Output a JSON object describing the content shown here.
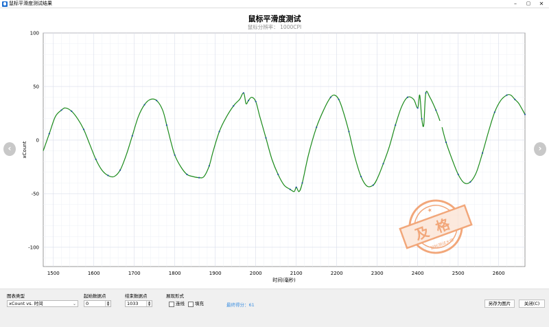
{
  "window": {
    "title": "鼠标平滑度测试结果",
    "minimize": "–",
    "maximize": "▢",
    "close": "✕"
  },
  "chart_data": {
    "type": "line",
    "title": "鼠标平滑度测试",
    "subtitle": "鼠标分辨率： 1000CPI",
    "xlabel": "时间(毫秒)",
    "ylabel": "xCount",
    "xlim": [
      1475,
      2665
    ],
    "ylim": [
      -118,
      100
    ],
    "xticks": [
      1500,
      1600,
      1700,
      1800,
      1900,
      2000,
      2100,
      2200,
      2300,
      2400,
      2500,
      2600
    ],
    "yticks": [
      100,
      50,
      0,
      -50,
      -100
    ],
    "grid": true,
    "series": [
      {
        "color": "#1a8a1a",
        "x": [
          1475,
          1490,
          1505,
          1520,
          1530,
          1545,
          1560,
          1575,
          1590,
          1605,
          1620,
          1635,
          1650,
          1665,
          1680,
          1695,
          1710,
          1725,
          1740,
          1755,
          1770,
          1780,
          1790,
          1800,
          1815,
          1830,
          1845,
          1860,
          1872,
          1885,
          1895,
          1910,
          1925,
          1945,
          1960,
          1970,
          1976,
          1982,
          1990,
          2000,
          2010,
          2025,
          2040,
          2055,
          2070,
          2085,
          2095,
          2100,
          2107,
          2115,
          2130,
          2150,
          2170,
          2185,
          2195,
          2205,
          2215,
          2230,
          2245,
          2260,
          2275,
          2290,
          2300,
          2315,
          2330,
          2345,
          2360,
          2375,
          2390,
          2400,
          2405,
          2410,
          2415,
          2420,
          2430,
          2445,
          2455
        ],
        "y": [
          -10,
          6,
          22,
          28,
          30,
          27,
          20,
          10,
          -4,
          -18,
          -28,
          -33,
          -34,
          -28,
          -14,
          4,
          22,
          33,
          38,
          37,
          28,
          14,
          -1,
          -14,
          -25,
          -32,
          -34,
          -35,
          -34,
          -24,
          -10,
          8,
          20,
          32,
          38,
          44,
          34,
          37,
          40,
          36,
          22,
          2,
          -18,
          -32,
          -42,
          -46,
          -48,
          -44,
          -48,
          -40,
          -14,
          12,
          30,
          40,
          42,
          38,
          28,
          8,
          -16,
          -34,
          -43,
          -42,
          -36,
          -22,
          -6,
          14,
          31,
          40,
          38,
          30,
          42,
          20,
          14,
          44,
          40,
          28,
          18
        ]
      },
      {
        "color": "#1a8a1a",
        "x": [
          2460,
          2470,
          2485,
          2500,
          2515,
          2530,
          2545,
          2560,
          2575,
          2590,
          2605,
          2620,
          2630,
          2640,
          2650,
          2665
        ],
        "y": [
          12,
          -2,
          -18,
          -32,
          -40,
          -39,
          -30,
          -12,
          8,
          26,
          37,
          42,
          42,
          38,
          34,
          24
        ]
      }
    ],
    "points_color": "#2050a0"
  },
  "controls": {
    "chart_type_label": "图表类型",
    "chart_type_value": "xCount vs. 时间",
    "start_point_label": "起始数据点",
    "start_point_value": "0",
    "end_point_label": "结束数据点",
    "end_point_value": "1033",
    "display_mode_label": "展现形式",
    "line_label": "连线",
    "fill_label": "填充",
    "score_text": "最终得分：61",
    "save_image_label": "另存为图片",
    "close_label": "关闭(C)"
  },
  "stamp": {
    "text": "及格",
    "ring_text": "鼠标测试大师"
  },
  "icons": {
    "prev": "chevron-left-icon",
    "next": "chevron-right-icon"
  }
}
